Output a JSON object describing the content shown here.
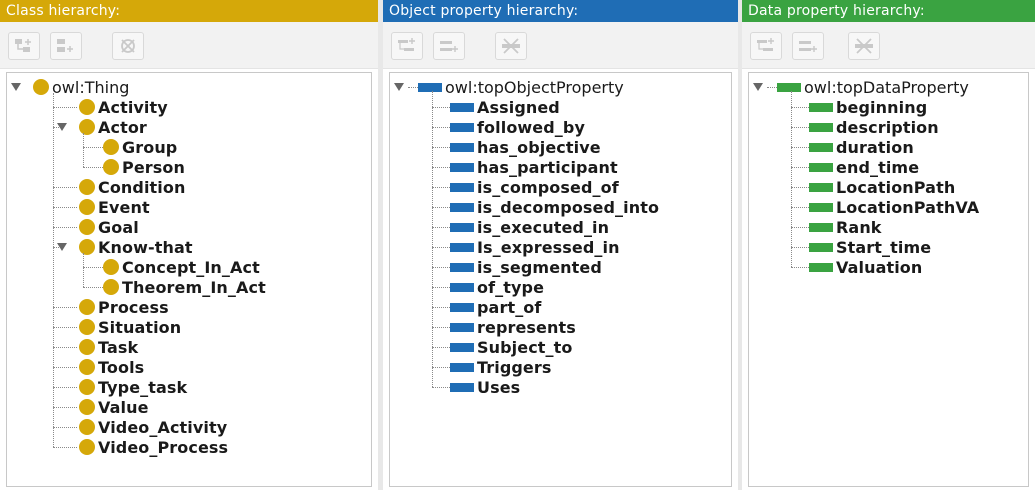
{
  "colors": {
    "class_header": "#d5a809",
    "object_header": "#1f6db5",
    "data_header": "#3aa341"
  },
  "class_panel": {
    "title": "Class hierarchy:",
    "toolbar": [
      "add-subclass-icon",
      "add-sibling-class-icon",
      "delete-class-icon"
    ],
    "root": "owl:Thing",
    "items": [
      {
        "label": "Activity",
        "depth": 1
      },
      {
        "label": "Actor",
        "depth": 1,
        "expanded": true
      },
      {
        "label": "Group",
        "depth": 2
      },
      {
        "label": "Person",
        "depth": 2
      },
      {
        "label": "Condition",
        "depth": 1
      },
      {
        "label": "Event",
        "depth": 1
      },
      {
        "label": "Goal",
        "depth": 1
      },
      {
        "label": "Know-that",
        "depth": 1,
        "expanded": true
      },
      {
        "label": "Concept_In_Act",
        "depth": 2
      },
      {
        "label": "Theorem_In_Act",
        "depth": 2
      },
      {
        "label": "Process",
        "depth": 1
      },
      {
        "label": "Situation",
        "depth": 1
      },
      {
        "label": "Task",
        "depth": 1
      },
      {
        "label": "Tools",
        "depth": 1
      },
      {
        "label": "Type_task",
        "depth": 1
      },
      {
        "label": "Value",
        "depth": 1
      },
      {
        "label": "Video_Activity",
        "depth": 1
      },
      {
        "label": "Video_Process",
        "depth": 1
      }
    ]
  },
  "object_panel": {
    "title": "Object property hierarchy:",
    "toolbar": [
      "add-sub-property-icon",
      "add-sibling-property-icon",
      "delete-property-icon"
    ],
    "root": "owl:topObjectProperty",
    "items": [
      "Assigned",
      "followed_by",
      "has_objective",
      "has_participant",
      "is_composed_of",
      "is_decomposed_into",
      "is_executed_in",
      "Is_expressed_in",
      "is_segmented",
      "of_type",
      "part_of",
      "represents",
      "Subject_to",
      "Triggers",
      "Uses"
    ]
  },
  "data_panel": {
    "title": "Data property hierarchy:",
    "toolbar": [
      "add-sub-property-icon",
      "add-sibling-property-icon",
      "delete-property-icon"
    ],
    "root": "owl:topDataProperty",
    "items": [
      "beginning",
      "description",
      "duration",
      "end_time",
      "LocationPath",
      "LocationPathVA",
      "Rank",
      "Start_time",
      "Valuation"
    ]
  }
}
